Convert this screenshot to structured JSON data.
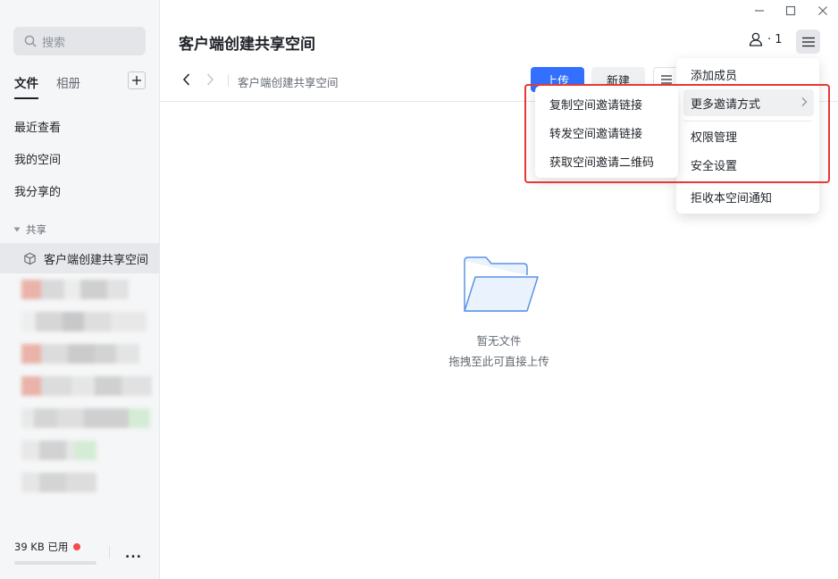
{
  "sidebar": {
    "search_placeholder": "搜索",
    "tabs": [
      {
        "label": "文件",
        "active": true
      },
      {
        "label": "相册",
        "active": false
      }
    ],
    "nav_items": [
      "最近查看",
      "我的空间",
      "我分享的"
    ],
    "section_label": "共享",
    "selected_space": "客户端创建共享空间",
    "storage_text": "39 KB 已用",
    "more_label": "..."
  },
  "header": {
    "title": "客户端创建共享空间",
    "member_count": "· 1"
  },
  "toolbar": {
    "breadcrumb": "客户端创建共享空间",
    "upload_label": "上传",
    "new_label": "新建"
  },
  "empty_state": {
    "title": "暂无文件",
    "subtitle": "拖拽至此可直接上传"
  },
  "menu": {
    "items": [
      "添加成员",
      "更多邀请方式",
      "权限管理",
      "安全设置",
      "拒收本空间通知"
    ]
  },
  "submenu": {
    "items": [
      "复制空间邀请链接",
      "转发空间邀请链接",
      "获取空间邀请二维码"
    ]
  },
  "colors": {
    "accent": "#3370ff",
    "highlight": "#e53935",
    "sidebar_bg": "#f5f6f7",
    "status_dot": "#f54a45"
  }
}
